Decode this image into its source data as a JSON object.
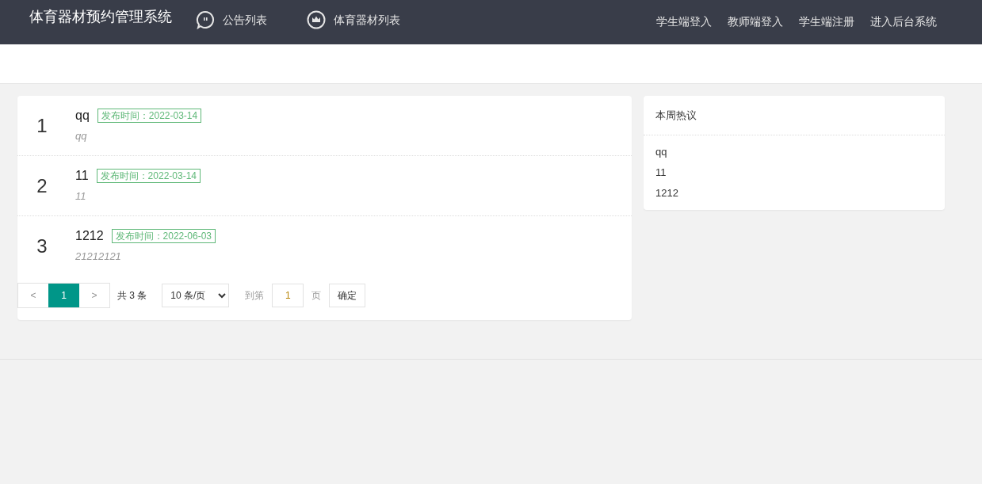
{
  "header": {
    "title": "体育器材预约管理系统",
    "nav": [
      {
        "label": "公告列表",
        "kind": "chat"
      },
      {
        "label": "体育器材列表",
        "kind": "crown"
      }
    ],
    "links": [
      "学生端登入",
      "教师端登入",
      "学生端注册",
      "进入后台系统"
    ]
  },
  "notices": [
    {
      "index": "1",
      "title": "qq",
      "tag": "发布时间：2022-03-14",
      "summary": "qq"
    },
    {
      "index": "2",
      "title": "11",
      "tag": "发布时间：2022-03-14",
      "summary": "11"
    },
    {
      "index": "3",
      "title": "1212",
      "tag": "发布时间：2022-06-03",
      "summary": "21212121"
    }
  ],
  "pagination": {
    "prev": {
      "label": "<",
      "disabled": true
    },
    "pages": [
      {
        "label": "1",
        "selected": true
      }
    ],
    "next": {
      "label": ">",
      "disabled": true
    },
    "total": "共 3 条",
    "page_size": "10 条/页",
    "goto_label": "到第",
    "goto_value": "1",
    "page_suffix": "页",
    "confirm": "确定"
  },
  "hot": {
    "title": "本周热议",
    "items": [
      "qq",
      "11",
      "1212"
    ]
  }
}
